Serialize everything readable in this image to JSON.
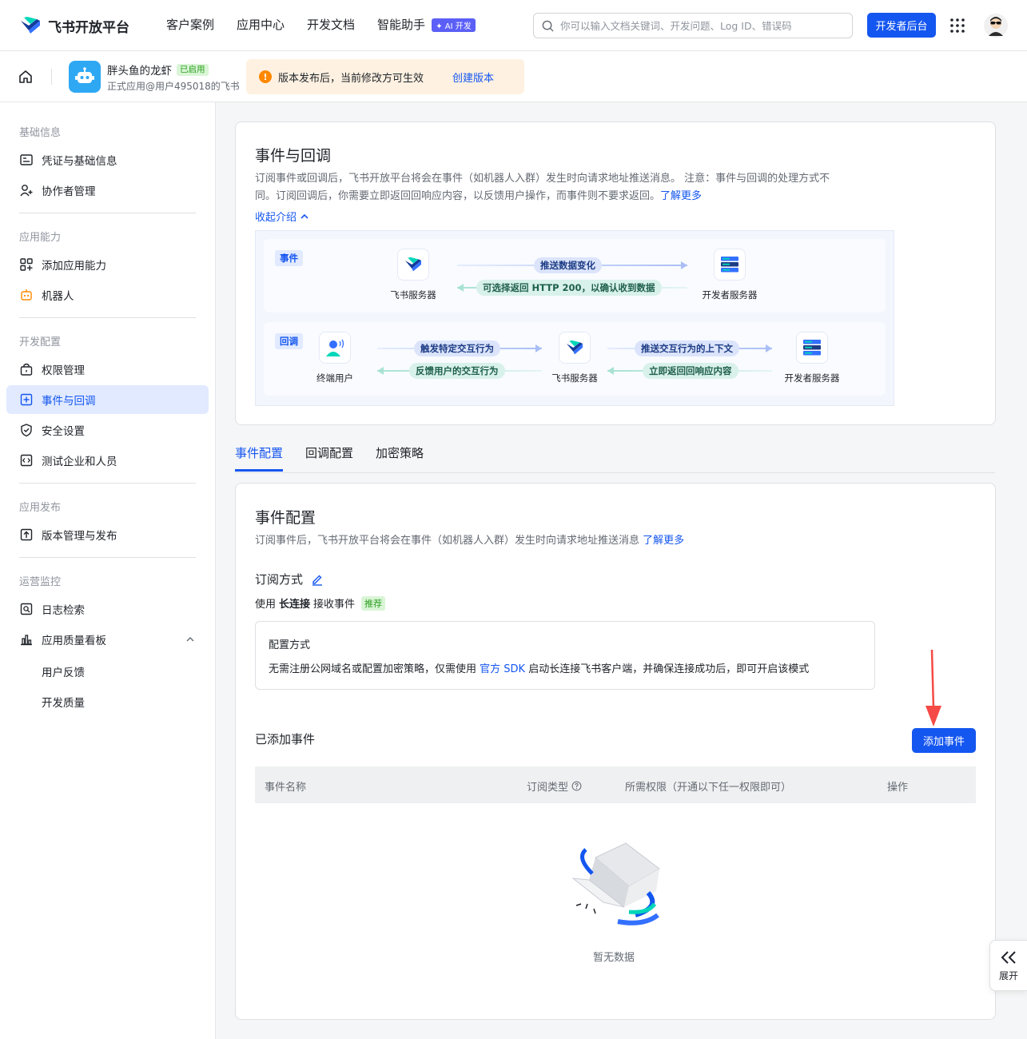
{
  "header": {
    "brand": "飞书开放平台",
    "nav": [
      "客户案例",
      "应用中心",
      "开发文档",
      "智能助手"
    ],
    "ai_badge": "✦ AI 开发",
    "search_placeholder": "你可以输入文档关键词、开发问题、Log ID、错误码",
    "dev_console": "开发者后台"
  },
  "app": {
    "name": "胖头鱼的龙虾",
    "status": "已启用",
    "subtitle": "正式应用@用户495018的飞书",
    "notice": "版本发布后，当前修改方可生效",
    "notice_link": "创建版本"
  },
  "sidebar": {
    "sections": [
      {
        "title": "基础信息",
        "items": [
          "凭证与基础信息",
          "协作者管理"
        ]
      },
      {
        "title": "应用能力",
        "items": [
          "添加应用能力",
          "机器人"
        ]
      },
      {
        "title": "开发配置",
        "items": [
          "权限管理",
          "事件与回调",
          "安全设置",
          "测试企业和人员"
        ]
      },
      {
        "title": "应用发布",
        "items": [
          "版本管理与发布"
        ]
      },
      {
        "title": "运营监控",
        "items": [
          "日志检索",
          "应用质量看板"
        ]
      }
    ],
    "subitems": [
      "用户反馈",
      "开发质量"
    ]
  },
  "intro": {
    "title": "事件与回调",
    "desc1": "订阅事件或回调后，飞书开放平台将会在事件（如机器人入群）发生时向请求地址推送消息。 注意：事件与回调的处理方式不",
    "desc2": "同。订阅回调后，你需要立即返回回响应内容，以反馈用户操作，而事件则不要求返回。",
    "learn_more": "了解更多",
    "collapse": "收起介绍"
  },
  "diagram": {
    "event": {
      "tag": "事件",
      "from": "飞书服务器",
      "to": "开发者服务器",
      "push": "推送数据变化",
      "ack": "可选择返回 HTTP 200，以确认收到数据"
    },
    "callback": {
      "tag": "回调",
      "user": "终端用户",
      "server": "飞书服务器",
      "dev": "开发者服务器",
      "trigger": "触发特定交互行为",
      "feedback": "反馈用户的交互行为",
      "push_ctx": "推送交互行为的上下文",
      "respond": "立即返回回响应内容"
    }
  },
  "tabs": [
    "事件配置",
    "回调配置",
    "加密策略"
  ],
  "event_config": {
    "title": "事件配置",
    "desc": "订阅事件后，飞书开放平台将会在事件（如机器人入群）发生时向请求地址推送消息",
    "learn_more": "了解更多",
    "subscribe_title": "订阅方式",
    "mode_prefix": "使用",
    "mode_strong": "长连接",
    "mode_suffix": "接收事件",
    "recommend": "推荐",
    "config_title": "配置方式",
    "config_pre": "无需注册公网域名或配置加密策略，仅需使用",
    "config_link": "官方 SDK",
    "config_post": "启动长连接飞书客户端，并确保连接成功后，即可开启该模式",
    "added_title": "已添加事件",
    "add_button": "添加事件",
    "columns": [
      "事件名称",
      "订阅类型",
      "所需权限（开通以下任一权限即可）",
      "操作"
    ],
    "empty": "暂无数据"
  },
  "expand_label": "展开",
  "colors": {
    "primary": "#1456f0",
    "success": "#2ea121",
    "warning": "#ff8800",
    "annotation": "#f54a45"
  }
}
